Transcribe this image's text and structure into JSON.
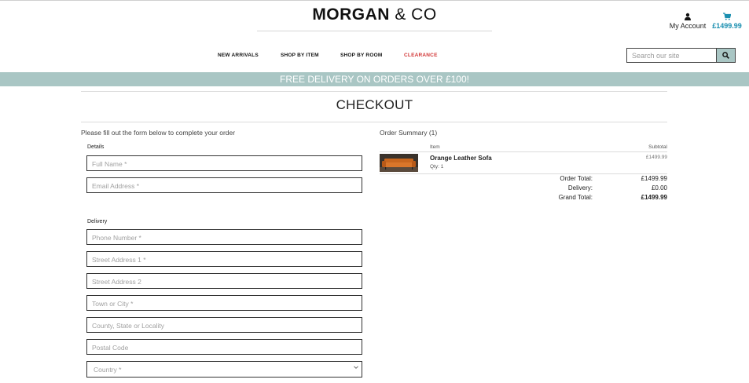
{
  "header": {
    "brand_bold": "MORGAN",
    "brand_rest": "& CO",
    "account_label": "My Account",
    "cart_total": "£1499.99"
  },
  "nav": {
    "items": [
      {
        "label": "NEW ARRIVALS"
      },
      {
        "label": "SHOP BY ITEM"
      },
      {
        "label": "SHOP BY ROOM"
      },
      {
        "label": "CLEARANCE"
      }
    ]
  },
  "search": {
    "placeholder": "Search our site"
  },
  "banner": {
    "text": "FREE DELIVERY ON ORDERS OVER £100!"
  },
  "page": {
    "title": "CHECKOUT",
    "intro": "Please fill out the form below to complete your order"
  },
  "form": {
    "details_label": "Details",
    "delivery_label": "Delivery",
    "full_name_placeholder": "Full Name *",
    "email_placeholder": "Email Address *",
    "phone_placeholder": "Phone Number *",
    "street1_placeholder": "Street Address 1 *",
    "street2_placeholder": "Street Address 2",
    "town_placeholder": "Town or City *",
    "county_placeholder": "County, State or Locality",
    "postal_placeholder": "Postal Code",
    "country_placeholder": "Country *"
  },
  "summary": {
    "title": "Order Summary (1)",
    "col_item": "Item",
    "col_subtotal": "Subtotal",
    "product": {
      "name": "Orange Leather Sofa",
      "qty": "Qty: 1",
      "subtotal": "£1499.99"
    },
    "order_total_label": "Order Total:",
    "order_total": "£1499.99",
    "delivery_label": "Delivery:",
    "delivery": "£0.00",
    "grand_total_label": "Grand Total:",
    "grand_total": "£1499.99"
  },
  "colors": {
    "accent": "#a9c6c4",
    "cart_blue": "#1b8fb0",
    "clearance_red": "#d23636"
  },
  "icons": {
    "account": "user-icon",
    "cart": "cart-icon",
    "search": "search-icon",
    "select": "chevron-down-icon"
  }
}
